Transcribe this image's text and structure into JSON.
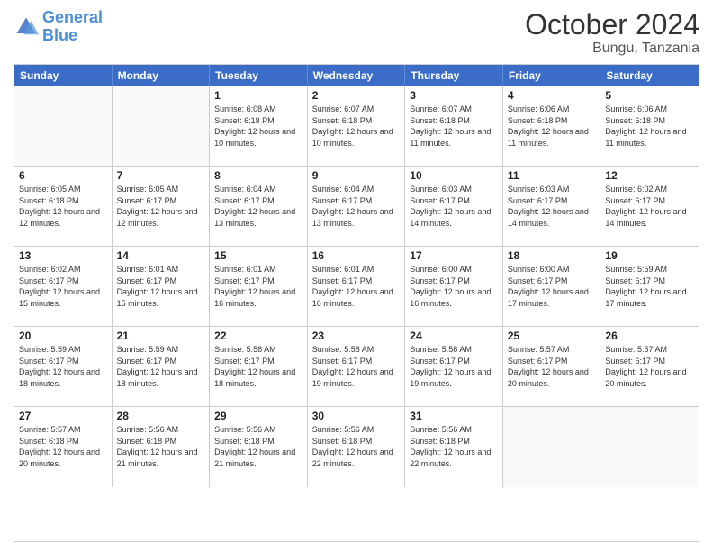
{
  "logo": {
    "line1": "General",
    "line2": "Blue"
  },
  "header": {
    "month": "October 2024",
    "location": "Bungu, Tanzania"
  },
  "weekdays": [
    "Sunday",
    "Monday",
    "Tuesday",
    "Wednesday",
    "Thursday",
    "Friday",
    "Saturday"
  ],
  "rows": [
    [
      {
        "day": "",
        "empty": true
      },
      {
        "day": "",
        "empty": true
      },
      {
        "day": "1",
        "sunrise": "6:08 AM",
        "sunset": "6:18 PM",
        "daylight": "12 hours and 10 minutes."
      },
      {
        "day": "2",
        "sunrise": "6:07 AM",
        "sunset": "6:18 PM",
        "daylight": "12 hours and 10 minutes."
      },
      {
        "day": "3",
        "sunrise": "6:07 AM",
        "sunset": "6:18 PM",
        "daylight": "12 hours and 11 minutes."
      },
      {
        "day": "4",
        "sunrise": "6:06 AM",
        "sunset": "6:18 PM",
        "daylight": "12 hours and 11 minutes."
      },
      {
        "day": "5",
        "sunrise": "6:06 AM",
        "sunset": "6:18 PM",
        "daylight": "12 hours and 11 minutes."
      }
    ],
    [
      {
        "day": "6",
        "sunrise": "6:05 AM",
        "sunset": "6:18 PM",
        "daylight": "12 hours and 12 minutes."
      },
      {
        "day": "7",
        "sunrise": "6:05 AM",
        "sunset": "6:17 PM",
        "daylight": "12 hours and 12 minutes."
      },
      {
        "day": "8",
        "sunrise": "6:04 AM",
        "sunset": "6:17 PM",
        "daylight": "12 hours and 13 minutes."
      },
      {
        "day": "9",
        "sunrise": "6:04 AM",
        "sunset": "6:17 PM",
        "daylight": "12 hours and 13 minutes."
      },
      {
        "day": "10",
        "sunrise": "6:03 AM",
        "sunset": "6:17 PM",
        "daylight": "12 hours and 14 minutes."
      },
      {
        "day": "11",
        "sunrise": "6:03 AM",
        "sunset": "6:17 PM",
        "daylight": "12 hours and 14 minutes."
      },
      {
        "day": "12",
        "sunrise": "6:02 AM",
        "sunset": "6:17 PM",
        "daylight": "12 hours and 14 minutes."
      }
    ],
    [
      {
        "day": "13",
        "sunrise": "6:02 AM",
        "sunset": "6:17 PM",
        "daylight": "12 hours and 15 minutes."
      },
      {
        "day": "14",
        "sunrise": "6:01 AM",
        "sunset": "6:17 PM",
        "daylight": "12 hours and 15 minutes."
      },
      {
        "day": "15",
        "sunrise": "6:01 AM",
        "sunset": "6:17 PM",
        "daylight": "12 hours and 16 minutes."
      },
      {
        "day": "16",
        "sunrise": "6:01 AM",
        "sunset": "6:17 PM",
        "daylight": "12 hours and 16 minutes."
      },
      {
        "day": "17",
        "sunrise": "6:00 AM",
        "sunset": "6:17 PM",
        "daylight": "12 hours and 16 minutes."
      },
      {
        "day": "18",
        "sunrise": "6:00 AM",
        "sunset": "6:17 PM",
        "daylight": "12 hours and 17 minutes."
      },
      {
        "day": "19",
        "sunrise": "5:59 AM",
        "sunset": "6:17 PM",
        "daylight": "12 hours and 17 minutes."
      }
    ],
    [
      {
        "day": "20",
        "sunrise": "5:59 AM",
        "sunset": "6:17 PM",
        "daylight": "12 hours and 18 minutes."
      },
      {
        "day": "21",
        "sunrise": "5:59 AM",
        "sunset": "6:17 PM",
        "daylight": "12 hours and 18 minutes."
      },
      {
        "day": "22",
        "sunrise": "5:58 AM",
        "sunset": "6:17 PM",
        "daylight": "12 hours and 18 minutes."
      },
      {
        "day": "23",
        "sunrise": "5:58 AM",
        "sunset": "6:17 PM",
        "daylight": "12 hours and 19 minutes."
      },
      {
        "day": "24",
        "sunrise": "5:58 AM",
        "sunset": "6:17 PM",
        "daylight": "12 hours and 19 minutes."
      },
      {
        "day": "25",
        "sunrise": "5:57 AM",
        "sunset": "6:17 PM",
        "daylight": "12 hours and 20 minutes."
      },
      {
        "day": "26",
        "sunrise": "5:57 AM",
        "sunset": "6:17 PM",
        "daylight": "12 hours and 20 minutes."
      }
    ],
    [
      {
        "day": "27",
        "sunrise": "5:57 AM",
        "sunset": "6:18 PM",
        "daylight": "12 hours and 20 minutes."
      },
      {
        "day": "28",
        "sunrise": "5:56 AM",
        "sunset": "6:18 PM",
        "daylight": "12 hours and 21 minutes."
      },
      {
        "day": "29",
        "sunrise": "5:56 AM",
        "sunset": "6:18 PM",
        "daylight": "12 hours and 21 minutes."
      },
      {
        "day": "30",
        "sunrise": "5:56 AM",
        "sunset": "6:18 PM",
        "daylight": "12 hours and 22 minutes."
      },
      {
        "day": "31",
        "sunrise": "5:56 AM",
        "sunset": "6:18 PM",
        "daylight": "12 hours and 22 minutes."
      },
      {
        "day": "",
        "empty": true
      },
      {
        "day": "",
        "empty": true
      }
    ]
  ]
}
